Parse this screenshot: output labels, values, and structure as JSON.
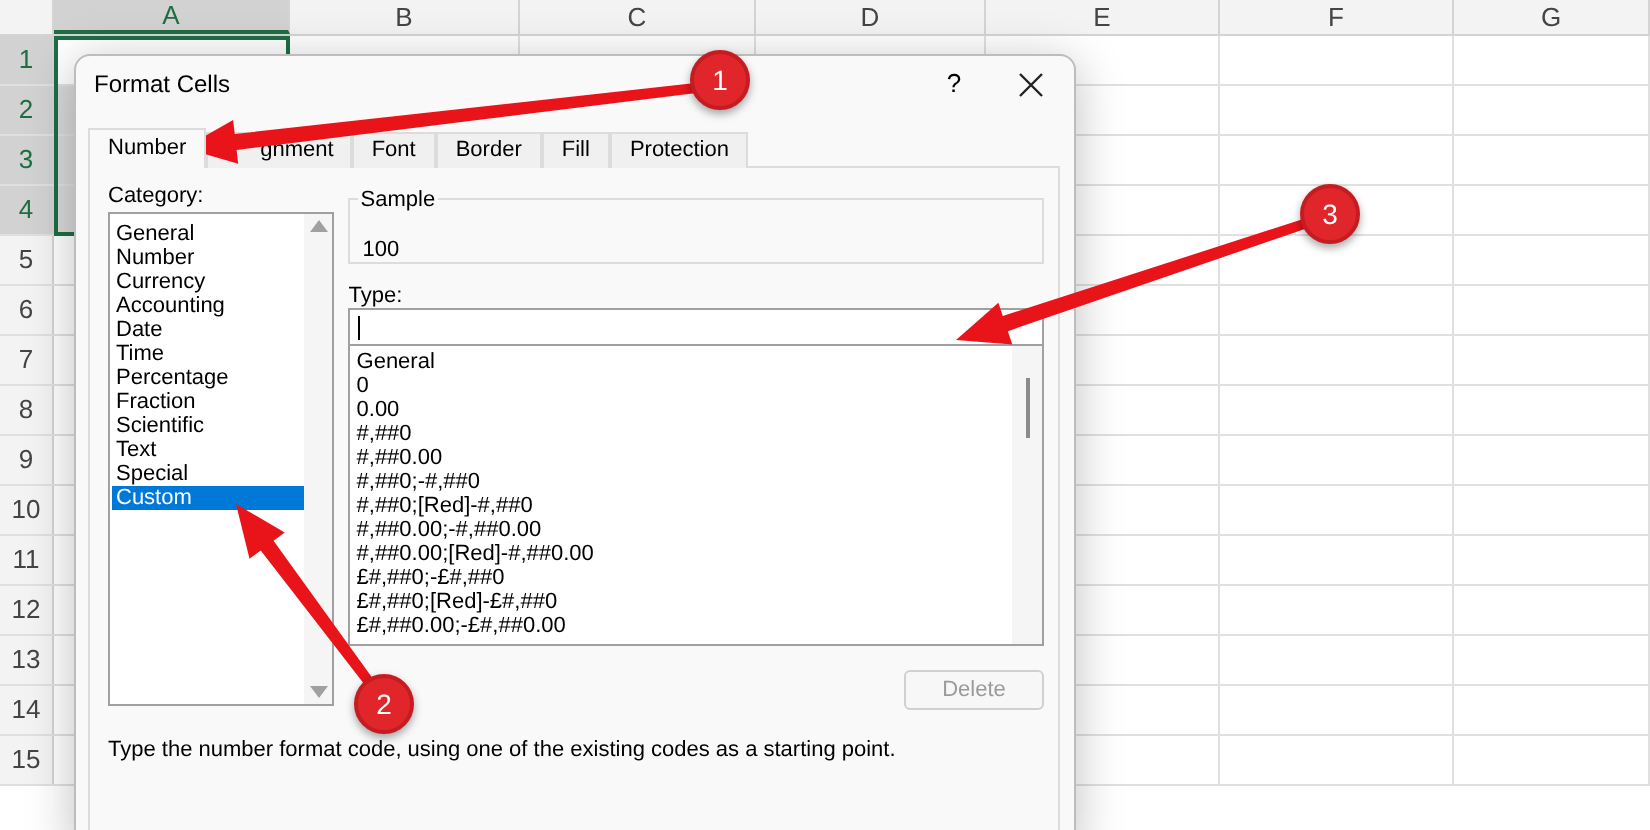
{
  "sheet": {
    "columns": [
      "A",
      "B",
      "C",
      "D",
      "E",
      "F",
      "G"
    ],
    "rows": [
      "1",
      "2",
      "3",
      "4",
      "5",
      "6",
      "7",
      "8",
      "9",
      "10",
      "11",
      "12",
      "13",
      "14",
      "15"
    ]
  },
  "dialog": {
    "title": "Format Cells",
    "help": "?",
    "tabs": [
      {
        "label": "Number",
        "selected": true
      },
      {
        "label": "gnment",
        "selected": false
      },
      {
        "label": "Font",
        "selected": false
      },
      {
        "label": "Border",
        "selected": false
      },
      {
        "label": "Fill",
        "selected": false
      },
      {
        "label": "Protection",
        "selected": false
      }
    ],
    "category_label": "Category:",
    "categories": [
      {
        "label": "General",
        "selected": false
      },
      {
        "label": "Number",
        "selected": false
      },
      {
        "label": "Currency",
        "selected": false
      },
      {
        "label": "Accounting",
        "selected": false
      },
      {
        "label": "Date",
        "selected": false
      },
      {
        "label": "Time",
        "selected": false
      },
      {
        "label": "Percentage",
        "selected": false
      },
      {
        "label": "Fraction",
        "selected": false
      },
      {
        "label": "Scientific",
        "selected": false
      },
      {
        "label": "Text",
        "selected": false
      },
      {
        "label": "Special",
        "selected": false
      },
      {
        "label": "Custom",
        "selected": true
      }
    ],
    "sample": {
      "label": "Sample",
      "value": "100"
    },
    "type_label": "Type:",
    "types": [
      "General",
      "0",
      "0.00",
      "#,##0",
      "#,##0.00",
      "#,##0;-#,##0",
      "#,##0;[Red]-#,##0",
      "#,##0.00;-#,##0.00",
      "#,##0.00;[Red]-#,##0.00",
      "£#,##0;-£#,##0",
      "£#,##0;[Red]-£#,##0",
      "£#,##0.00;-£#,##0.00"
    ],
    "delete_button": {
      "label": "Delete",
      "disabled": true
    },
    "description": "Type the number format code, using one of the existing codes as a starting point."
  },
  "annotations": [
    {
      "number": "1"
    },
    {
      "number": "2"
    },
    {
      "number": "3"
    }
  ]
}
